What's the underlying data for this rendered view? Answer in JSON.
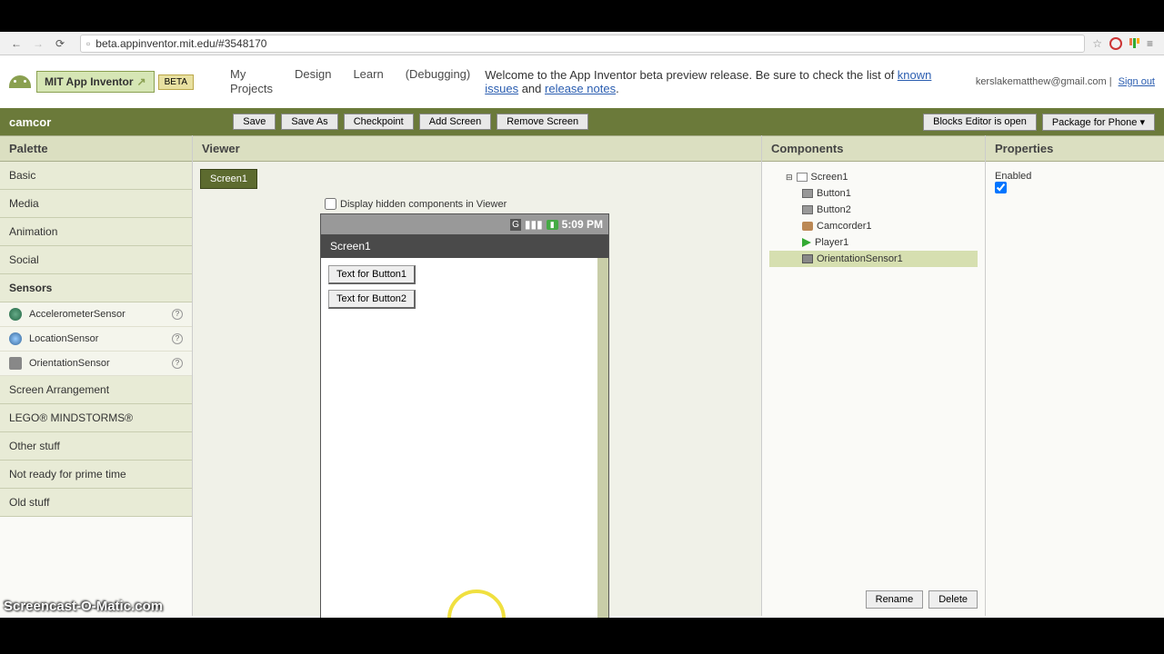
{
  "browser": {
    "url": "beta.appinventor.mit.edu/#3548170"
  },
  "header": {
    "logo_text": "MIT App Inventor",
    "beta": "BETA",
    "nav": {
      "my_projects": "My\nProjects",
      "design": "Design",
      "learn": "Learn",
      "debugging": "(Debugging)"
    },
    "welcome_pre": "Welcome to the App Inventor beta preview release. Be sure to check the list of ",
    "known_issues": "known issues",
    "welcome_and": " and ",
    "release_notes": "release notes",
    "welcome_end": ".",
    "user_email": "kerslakematthew@gmail.com",
    "sign_out": "Sign out"
  },
  "toolbar": {
    "project_name": "camcor",
    "save": "Save",
    "save_as": "Save As",
    "checkpoint": "Checkpoint",
    "add_screen": "Add Screen",
    "remove_screen": "Remove Screen",
    "blocks_editor": "Blocks Editor is open",
    "package": "Package for Phone ▾"
  },
  "palette": {
    "title": "Palette",
    "cats": {
      "basic": "Basic",
      "media": "Media",
      "animation": "Animation",
      "social": "Social",
      "sensors": "Sensors",
      "screen_arr": "Screen Arrangement",
      "lego": "LEGO® MINDSTORMS®",
      "other": "Other stuff",
      "not_ready": "Not ready for prime time",
      "old": "Old stuff"
    },
    "sensor_items": {
      "accel": "AccelerometerSensor",
      "loc": "LocationSensor",
      "orient": "OrientationSensor"
    }
  },
  "viewer": {
    "title": "Viewer",
    "screen_tab": "Screen1",
    "display_hidden": "Display hidden components in Viewer",
    "phone_time": "5:09 PM",
    "screen_title": "Screen1",
    "button1": "Text for Button1",
    "button2": "Text for Button2",
    "tooltip": "Screen1"
  },
  "components": {
    "title": "Components",
    "tree": {
      "screen": "Screen1",
      "button1": "Button1",
      "button2": "Button2",
      "camcorder": "Camcorder1",
      "player": "Player1",
      "orient": "OrientationSensor1"
    },
    "rename": "Rename",
    "delete": "Delete"
  },
  "properties": {
    "title": "Properties",
    "enabled": "Enabled"
  },
  "watermark": "Screencast-O-Matic.com"
}
